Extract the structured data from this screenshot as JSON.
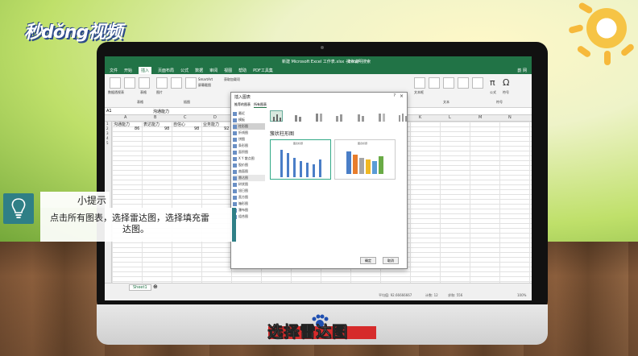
{
  "brand": {
    "logo_text": "秒dǒng视频"
  },
  "excel": {
    "window_title": "新建 Microsoft Excel 工作表.xlsx - Excel",
    "tell_me": "操作说明搜索",
    "user": "韵 网",
    "tabs": [
      "文件",
      "开始",
      "插入",
      "页面布局",
      "公式",
      "数据",
      "审阅",
      "视图",
      "帮助",
      "PDF工具集"
    ],
    "active_tab": "插入",
    "ribbon_groups": [
      "表格",
      "插图",
      "文本",
      "符号"
    ],
    "ribbon_buttons": [
      "数据透视表",
      "推荐的数据透视表",
      "表格",
      "图片",
      "联机图片",
      "形状",
      "SmartArt",
      "屏幕截图",
      "获取加载项",
      "我的加载项",
      "文本框",
      "页眉和页脚",
      "艺术字",
      "签名行",
      "对象",
      "公式",
      "符号"
    ],
    "name_box": "A1",
    "formula": "沟通能力",
    "columns": [
      "A",
      "B",
      "C",
      "D",
      "E",
      "F",
      "G",
      "H",
      "I",
      "J",
      "K",
      "L",
      "M",
      "N"
    ],
    "rows": [
      "1",
      "2",
      "3",
      "4",
      "5",
      "6",
      "7",
      "8",
      "9",
      "10",
      "11",
      "12",
      "13",
      "14",
      "15",
      "16",
      "17",
      "18",
      "19",
      "20",
      "21",
      "22",
      "23",
      "24",
      "25",
      "26",
      "27",
      "28",
      "29",
      "30",
      "31",
      "32"
    ],
    "headers": [
      "沟通能力",
      "表达能力",
      "自信心",
      "业务能力"
    ],
    "values": [
      "86",
      "98",
      "98",
      "92"
    ],
    "sheet_tab": "Sheet1",
    "status_avg": "平均值: 92.66666667",
    "status_count": "计数: 12",
    "status_sum": "求和: 556",
    "zoom": "100%"
  },
  "dialog": {
    "title": "插入图表",
    "help": "?",
    "close": "×",
    "tabs": [
      "推荐的图表",
      "所有图表"
    ],
    "active_tab": "所有图表",
    "chart_types": [
      "最近",
      "模板",
      "柱形图",
      "折线图",
      "饼图",
      "条形图",
      "面积图",
      "X Y 散点图",
      "股价图",
      "曲面图",
      "雷达图",
      "树状图",
      "旭日图",
      "直方图",
      "箱形图",
      "瀑布图",
      "组合图"
    ],
    "selected_type": "柱形图",
    "heading": "簇状柱形图",
    "preview_titles": [
      "图表标题",
      "图表标题"
    ],
    "ok": "确定",
    "cancel": "取消"
  },
  "tip": {
    "title": "小提示",
    "line1": "点击所有图表，选择雷达图，选择填充雷",
    "line2": "达图。"
  },
  "subtitle": "选择雷达图",
  "colors": {
    "excel_green": "#217346",
    "tip_teal": "#2f7f86",
    "subtitle_red": "#d62b2b"
  }
}
